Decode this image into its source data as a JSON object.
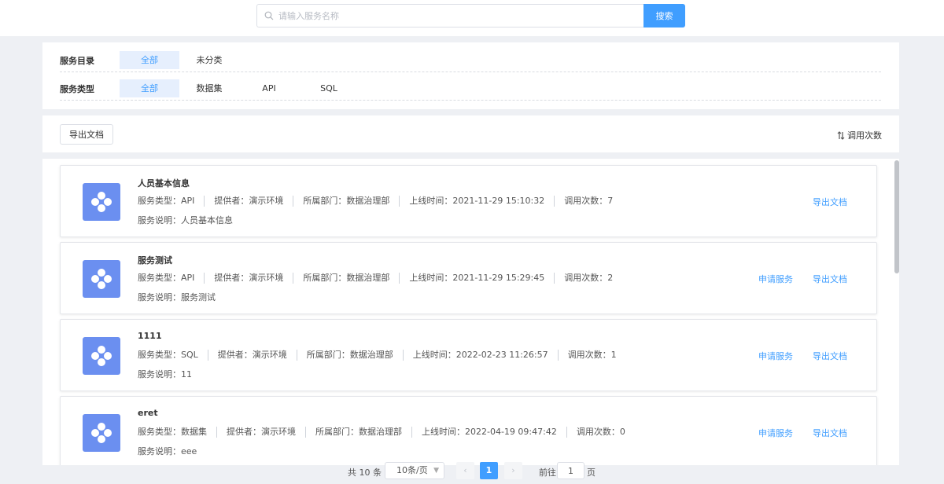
{
  "search": {
    "placeholder": "请输入服务名称",
    "button_label": "搜索"
  },
  "filters": {
    "catalog": {
      "label": "服务目录",
      "options": [
        "全部",
        "未分类"
      ],
      "selected": "全部"
    },
    "type": {
      "label": "服务类型",
      "options": [
        "全部",
        "数据集",
        "API",
        "SQL"
      ],
      "selected": "全部"
    }
  },
  "toolbar": {
    "export_label": "导出文档",
    "sort_label": "调用次数"
  },
  "services": [
    {
      "title": "人员基本信息",
      "type": "服务类型：API",
      "provider": "提供者：演示环境",
      "department": "所属部门：数据治理部",
      "online_time": "上线时间：2021-11-29 15:10:32",
      "calls": "调用次数：7",
      "description": "服务说明：人员基本信息",
      "apply_label": "",
      "export_label": "导出文档"
    },
    {
      "title": "服务测试",
      "type": "服务类型：API",
      "provider": "提供者：演示环境",
      "department": "所属部门：数据治理部",
      "online_time": "上线时间：2021-11-29 15:29:45",
      "calls": "调用次数：2",
      "description": "服务说明：服务测试",
      "apply_label": "申请服务",
      "export_label": "导出文档"
    },
    {
      "title": "1111",
      "type": "服务类型：SQL",
      "provider": "提供者：演示环境",
      "department": "所属部门：数据治理部",
      "online_time": "上线时间：2022-02-23 11:26:57",
      "calls": "调用次数：1",
      "description": "服务说明：11",
      "apply_label": "申请服务",
      "export_label": "导出文档"
    },
    {
      "title": "eret",
      "type": "服务类型：数据集",
      "provider": "提供者：演示环境",
      "department": "所属部门：数据治理部",
      "online_time": "上线时间：2022-04-19 09:47:42",
      "calls": "调用次数：0",
      "description": "服务说明：eee",
      "apply_label": "申请服务",
      "export_label": "导出文档"
    }
  ],
  "pagination": {
    "total": "共 10 条",
    "page_size": "10条/页",
    "current_page": "1",
    "goto_label": "前往",
    "goto_value": "1",
    "unit": "页"
  },
  "colors": {
    "accent": "#409eff",
    "logo_bg": "#6b8ff0",
    "active_filter_bg": "#e6effd",
    "page_bg": "#eef0f4"
  },
  "icons": [
    "search-icon",
    "sort-icon",
    "service-logo-icon",
    "chevron-left-icon",
    "chevron-right-icon",
    "chevron-down-icon"
  ]
}
